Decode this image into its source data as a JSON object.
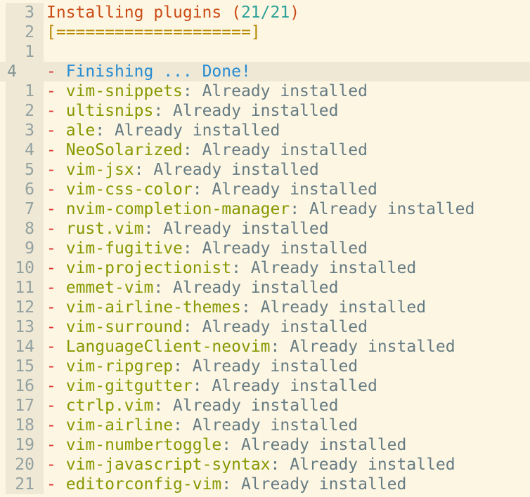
{
  "header": {
    "title_prefix": "Installing plugins (",
    "done": "21",
    "sep": "/",
    "total": "21",
    "title_suffix": ")",
    "progress_bar": "[====================]"
  },
  "relative_numbers": {
    "title": "3",
    "bar": "2",
    "blank": "1",
    "cursor": "4"
  },
  "finishing": {
    "dash": "-",
    "label": "Finishing ... Done!"
  },
  "status_text": ": Already installed",
  "plugins": [
    {
      "n": "1",
      "name": "vim-snippets"
    },
    {
      "n": "2",
      "name": "ultisnips"
    },
    {
      "n": "3",
      "name": "ale"
    },
    {
      "n": "4",
      "name": "NeoSolarized"
    },
    {
      "n": "5",
      "name": "vim-jsx"
    },
    {
      "n": "6",
      "name": "vim-css-color"
    },
    {
      "n": "7",
      "name": "nvim-completion-manager"
    },
    {
      "n": "8",
      "name": "rust.vim"
    },
    {
      "n": "9",
      "name": "vim-fugitive"
    },
    {
      "n": "10",
      "name": "vim-projectionist"
    },
    {
      "n": "11",
      "name": "emmet-vim"
    },
    {
      "n": "12",
      "name": "vim-airline-themes"
    },
    {
      "n": "13",
      "name": "vim-surround"
    },
    {
      "n": "14",
      "name": "LanguageClient-neovim"
    },
    {
      "n": "15",
      "name": "vim-ripgrep"
    },
    {
      "n": "16",
      "name": "vim-gitgutter"
    },
    {
      "n": "17",
      "name": "ctrlp.vim"
    },
    {
      "n": "18",
      "name": "vim-airline"
    },
    {
      "n": "19",
      "name": "vim-numbertoggle"
    },
    {
      "n": "20",
      "name": "vim-javascript-syntax"
    },
    {
      "n": "21",
      "name": "editorconfig-vim"
    }
  ]
}
